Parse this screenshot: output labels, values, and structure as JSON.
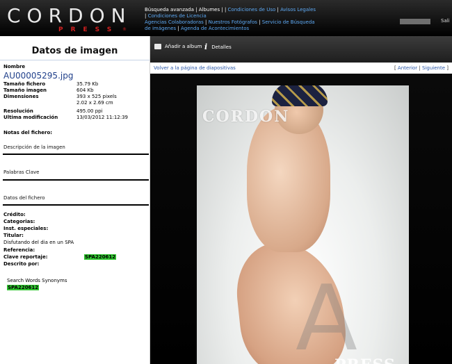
{
  "header": {
    "logo_main": "CORDON",
    "logo_sub": "PRESS",
    "logo_mark": "®",
    "nav": {
      "item1": "Búsqueda avanzada",
      "item2": "Albumes",
      "item3": "Condiciones de Uso",
      "item4": "Avisos Legales",
      "item5": "Condiciones de Licencia",
      "item6": "Agencias Colaboradoras",
      "item7": "Nuestros Fotógrafos",
      "item8": "Servicio de Búsqueda de imágenes",
      "item9": "Agenda de Acontecimientos"
    },
    "logout_partial": "Sali"
  },
  "left": {
    "title": "Datos de imagen",
    "nombre_label": "Nombre",
    "filename": "AU00005295.jpg",
    "tamano_fichero_label": "Tamaño fichero",
    "tamano_fichero_value": "35.79 Kb",
    "tamano_imagen_label": "Tamaño imagen",
    "tamano_imagen_value": "604 Kb",
    "dimensiones_label": "Dimensiones",
    "dimensiones_px": "393 x 525 pixels",
    "dimensiones_cm": "2.02 x 2.69 cm",
    "resolucion_label": "Resolución",
    "resolucion_value": "495.00 ppi",
    "ultima_label": "Ultima modificación",
    "ultima_value": "13/03/2012 11:12:39",
    "notas_label": "Notas del fichero:",
    "descripcion_label": "Descripción de la imagen",
    "palabras_label": "Palabras Clave",
    "datos_label": "Datos del fichero",
    "credito_label": "Crédito:",
    "categorias_label": "Categorias:",
    "inst_label": "Inst. especiales:",
    "titular_label": "Titular:",
    "titular_value": "Disfutando del dia en un SPA",
    "referencia_label": "Referencia:",
    "clave_label": "Clave reportaje:",
    "clave_value": "SPA220612",
    "descrito_label": "Descrito por:",
    "synonyms_label": "Search Words Synonyms",
    "synonyms_value": "SPA220612"
  },
  "right": {
    "add_album": "Añadir a album",
    "details": "Detalles",
    "back_link": "Volver a la página de diapositivas",
    "prev": "Anterior",
    "next": "Siguiente",
    "watermark_top": "CORDON",
    "watermark_a": "A",
    "watermark_press": "PRESS"
  }
}
